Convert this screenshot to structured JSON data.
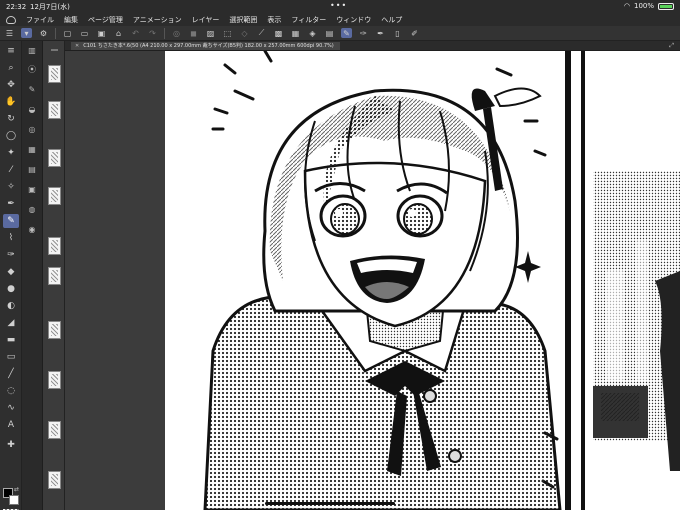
{
  "status": {
    "time": "22:32",
    "date": "12月7日(水)",
    "battery": "100%"
  },
  "menu": [
    "ファイル",
    "編集",
    "ページ管理",
    "アニメーション",
    "レイヤー",
    "選択範囲",
    "表示",
    "フィルター",
    "ウィンドウ",
    "ヘルプ"
  ],
  "document": {
    "tab_label": "C101 ちさたき本*.6(50 (A4 210.00 x 297.00mm 裁ちサイズ(B5判) 182.00 x 257.00mm 600dpi 90.7%)"
  },
  "tools": [
    "zoom-icon",
    "move-icon",
    "hand-icon",
    "lasso-icon",
    "eyedropper-icon",
    "pen-icon",
    "brush-icon",
    "eraser-icon",
    "fill-icon",
    "gradient-icon",
    "figure-icon",
    "text-icon",
    "balloon-icon"
  ],
  "colors": {
    "accent": "#5a6aa0",
    "main_color": "#000000",
    "sub_color": "#ffffff"
  }
}
